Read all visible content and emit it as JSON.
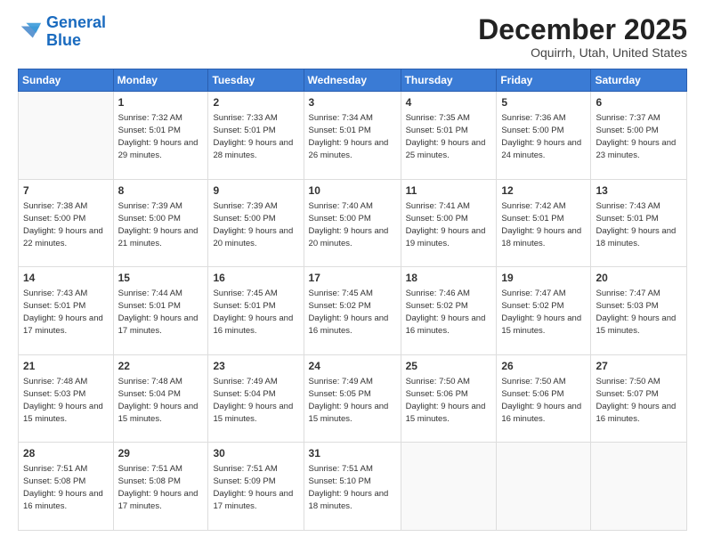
{
  "logo": {
    "line1": "General",
    "line2": "Blue"
  },
  "title": "December 2025",
  "location": "Oquirrh, Utah, United States",
  "days_of_week": [
    "Sunday",
    "Monday",
    "Tuesday",
    "Wednesday",
    "Thursday",
    "Friday",
    "Saturday"
  ],
  "weeks": [
    [
      {
        "day": "",
        "sunrise": "",
        "sunset": "",
        "daylight": ""
      },
      {
        "day": "1",
        "sunrise": "Sunrise: 7:32 AM",
        "sunset": "Sunset: 5:01 PM",
        "daylight": "Daylight: 9 hours and 29 minutes."
      },
      {
        "day": "2",
        "sunrise": "Sunrise: 7:33 AM",
        "sunset": "Sunset: 5:01 PM",
        "daylight": "Daylight: 9 hours and 28 minutes."
      },
      {
        "day": "3",
        "sunrise": "Sunrise: 7:34 AM",
        "sunset": "Sunset: 5:01 PM",
        "daylight": "Daylight: 9 hours and 26 minutes."
      },
      {
        "day": "4",
        "sunrise": "Sunrise: 7:35 AM",
        "sunset": "Sunset: 5:01 PM",
        "daylight": "Daylight: 9 hours and 25 minutes."
      },
      {
        "day": "5",
        "sunrise": "Sunrise: 7:36 AM",
        "sunset": "Sunset: 5:00 PM",
        "daylight": "Daylight: 9 hours and 24 minutes."
      },
      {
        "day": "6",
        "sunrise": "Sunrise: 7:37 AM",
        "sunset": "Sunset: 5:00 PM",
        "daylight": "Daylight: 9 hours and 23 minutes."
      }
    ],
    [
      {
        "day": "7",
        "sunrise": "Sunrise: 7:38 AM",
        "sunset": "Sunset: 5:00 PM",
        "daylight": "Daylight: 9 hours and 22 minutes."
      },
      {
        "day": "8",
        "sunrise": "Sunrise: 7:39 AM",
        "sunset": "Sunset: 5:00 PM",
        "daylight": "Daylight: 9 hours and 21 minutes."
      },
      {
        "day": "9",
        "sunrise": "Sunrise: 7:39 AM",
        "sunset": "Sunset: 5:00 PM",
        "daylight": "Daylight: 9 hours and 20 minutes."
      },
      {
        "day": "10",
        "sunrise": "Sunrise: 7:40 AM",
        "sunset": "Sunset: 5:00 PM",
        "daylight": "Daylight: 9 hours and 20 minutes."
      },
      {
        "day": "11",
        "sunrise": "Sunrise: 7:41 AM",
        "sunset": "Sunset: 5:00 PM",
        "daylight": "Daylight: 9 hours and 19 minutes."
      },
      {
        "day": "12",
        "sunrise": "Sunrise: 7:42 AM",
        "sunset": "Sunset: 5:01 PM",
        "daylight": "Daylight: 9 hours and 18 minutes."
      },
      {
        "day": "13",
        "sunrise": "Sunrise: 7:43 AM",
        "sunset": "Sunset: 5:01 PM",
        "daylight": "Daylight: 9 hours and 18 minutes."
      }
    ],
    [
      {
        "day": "14",
        "sunrise": "Sunrise: 7:43 AM",
        "sunset": "Sunset: 5:01 PM",
        "daylight": "Daylight: 9 hours and 17 minutes."
      },
      {
        "day": "15",
        "sunrise": "Sunrise: 7:44 AM",
        "sunset": "Sunset: 5:01 PM",
        "daylight": "Daylight: 9 hours and 17 minutes."
      },
      {
        "day": "16",
        "sunrise": "Sunrise: 7:45 AM",
        "sunset": "Sunset: 5:01 PM",
        "daylight": "Daylight: 9 hours and 16 minutes."
      },
      {
        "day": "17",
        "sunrise": "Sunrise: 7:45 AM",
        "sunset": "Sunset: 5:02 PM",
        "daylight": "Daylight: 9 hours and 16 minutes."
      },
      {
        "day": "18",
        "sunrise": "Sunrise: 7:46 AM",
        "sunset": "Sunset: 5:02 PM",
        "daylight": "Daylight: 9 hours and 16 minutes."
      },
      {
        "day": "19",
        "sunrise": "Sunrise: 7:47 AM",
        "sunset": "Sunset: 5:02 PM",
        "daylight": "Daylight: 9 hours and 15 minutes."
      },
      {
        "day": "20",
        "sunrise": "Sunrise: 7:47 AM",
        "sunset": "Sunset: 5:03 PM",
        "daylight": "Daylight: 9 hours and 15 minutes."
      }
    ],
    [
      {
        "day": "21",
        "sunrise": "Sunrise: 7:48 AM",
        "sunset": "Sunset: 5:03 PM",
        "daylight": "Daylight: 9 hours and 15 minutes."
      },
      {
        "day": "22",
        "sunrise": "Sunrise: 7:48 AM",
        "sunset": "Sunset: 5:04 PM",
        "daylight": "Daylight: 9 hours and 15 minutes."
      },
      {
        "day": "23",
        "sunrise": "Sunrise: 7:49 AM",
        "sunset": "Sunset: 5:04 PM",
        "daylight": "Daylight: 9 hours and 15 minutes."
      },
      {
        "day": "24",
        "sunrise": "Sunrise: 7:49 AM",
        "sunset": "Sunset: 5:05 PM",
        "daylight": "Daylight: 9 hours and 15 minutes."
      },
      {
        "day": "25",
        "sunrise": "Sunrise: 7:50 AM",
        "sunset": "Sunset: 5:06 PM",
        "daylight": "Daylight: 9 hours and 15 minutes."
      },
      {
        "day": "26",
        "sunrise": "Sunrise: 7:50 AM",
        "sunset": "Sunset: 5:06 PM",
        "daylight": "Daylight: 9 hours and 16 minutes."
      },
      {
        "day": "27",
        "sunrise": "Sunrise: 7:50 AM",
        "sunset": "Sunset: 5:07 PM",
        "daylight": "Daylight: 9 hours and 16 minutes."
      }
    ],
    [
      {
        "day": "28",
        "sunrise": "Sunrise: 7:51 AM",
        "sunset": "Sunset: 5:08 PM",
        "daylight": "Daylight: 9 hours and 16 minutes."
      },
      {
        "day": "29",
        "sunrise": "Sunrise: 7:51 AM",
        "sunset": "Sunset: 5:08 PM",
        "daylight": "Daylight: 9 hours and 17 minutes."
      },
      {
        "day": "30",
        "sunrise": "Sunrise: 7:51 AM",
        "sunset": "Sunset: 5:09 PM",
        "daylight": "Daylight: 9 hours and 17 minutes."
      },
      {
        "day": "31",
        "sunrise": "Sunrise: 7:51 AM",
        "sunset": "Sunset: 5:10 PM",
        "daylight": "Daylight: 9 hours and 18 minutes."
      },
      {
        "day": "",
        "sunrise": "",
        "sunset": "",
        "daylight": ""
      },
      {
        "day": "",
        "sunrise": "",
        "sunset": "",
        "daylight": ""
      },
      {
        "day": "",
        "sunrise": "",
        "sunset": "",
        "daylight": ""
      }
    ]
  ]
}
